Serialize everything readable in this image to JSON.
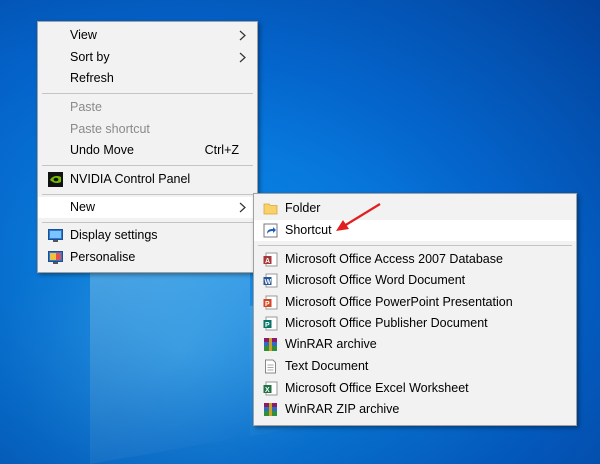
{
  "context_menu": {
    "items": [
      {
        "label": "View",
        "has_submenu": true
      },
      {
        "label": "Sort by",
        "has_submenu": true
      },
      {
        "label": "Refresh"
      },
      {
        "label": "Paste",
        "disabled": true
      },
      {
        "label": "Paste shortcut",
        "disabled": true
      },
      {
        "label": "Undo Move",
        "shortcut": "Ctrl+Z"
      },
      {
        "label": "NVIDIA Control Panel",
        "icon": "nvidia-icon"
      },
      {
        "label": "New",
        "has_submenu": true,
        "highlighted": true
      },
      {
        "label": "Display settings",
        "icon": "display-settings-icon"
      },
      {
        "label": "Personalise",
        "icon": "personalise-icon"
      }
    ]
  },
  "new_submenu": {
    "items": [
      {
        "label": "Folder",
        "icon": "folder-icon"
      },
      {
        "label": "Shortcut",
        "icon": "shortcut-icon",
        "highlighted": true
      },
      {
        "label": "Microsoft Office Access 2007 Database",
        "icon": "access-icon"
      },
      {
        "label": "Microsoft Office Word Document",
        "icon": "word-icon"
      },
      {
        "label": "Microsoft Office PowerPoint Presentation",
        "icon": "powerpoint-icon"
      },
      {
        "label": "Microsoft Office Publisher Document",
        "icon": "publisher-icon"
      },
      {
        "label": "WinRAR archive",
        "icon": "winrar-icon"
      },
      {
        "label": "Text Document",
        "icon": "text-document-icon"
      },
      {
        "label": "Microsoft Office Excel Worksheet",
        "icon": "excel-icon"
      },
      {
        "label": "WinRAR ZIP archive",
        "icon": "winrar-zip-icon"
      }
    ]
  },
  "colors": {
    "menu_bg": "#f2f2f2",
    "highlight_bg": "#ffffff",
    "disabled_text": "#8a8a8a",
    "annotation_arrow": "#e02020",
    "desktop_blue": "#0a86e8"
  }
}
